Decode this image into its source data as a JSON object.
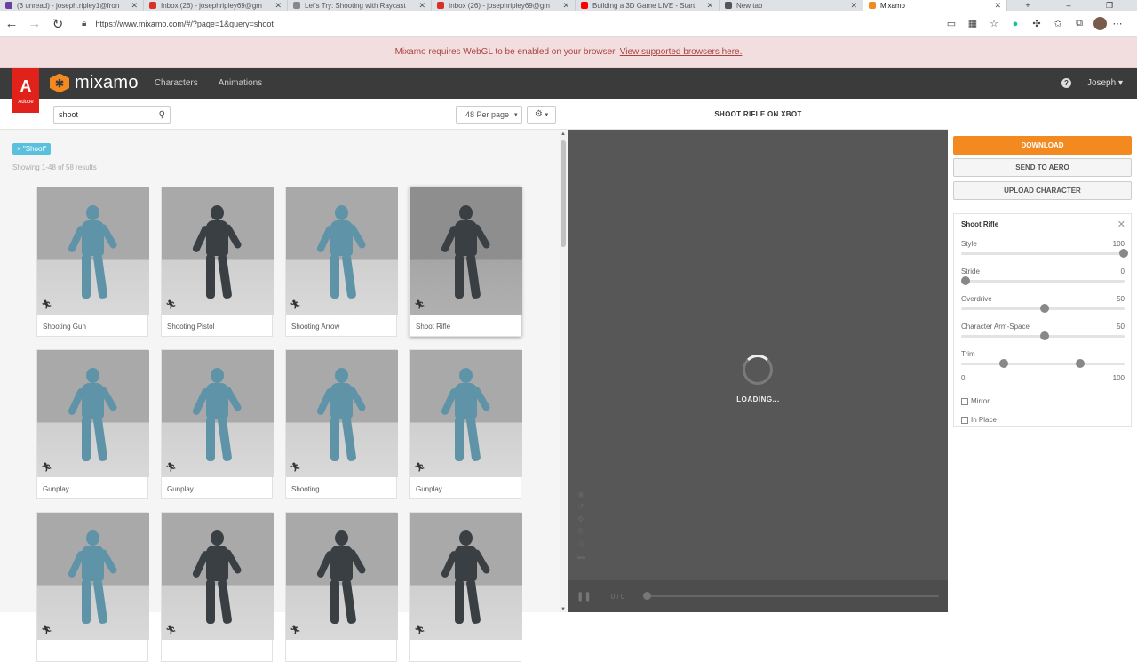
{
  "browser": {
    "tabs": [
      {
        "title": "(3 unread) - joseph.ripley1@fron",
        "color": "#6b3fa0"
      },
      {
        "title": "Inbox (26) - josephripley69@gm",
        "color": "#d93025"
      },
      {
        "title": "Let's Try: Shooting with Raycast",
        "color": "#888888"
      },
      {
        "title": "Inbox (26) - josephripley69@gm",
        "color": "#d93025"
      },
      {
        "title": "Building a 3D Game LIVE - Start",
        "color": "#ff0000"
      },
      {
        "title": "New tab",
        "color": "#555555"
      },
      {
        "title": "Mixamo",
        "color": "#f28a20"
      }
    ],
    "url": "https://www.mixamo.com/#/?page=1&query=shoot"
  },
  "webgl_banner": {
    "text": "Mixamo requires WebGL to be enabled on your browser.",
    "link": "View supported browsers here."
  },
  "header": {
    "adobe_label": "Adobe",
    "logo": "mixamo",
    "nav": [
      "Characters",
      "Animations"
    ],
    "user": "Joseph"
  },
  "search": {
    "query": "shoot",
    "per_page": "48 Per page",
    "tag": "× \"Shoot\"",
    "results": "Showing 1-48 of 58 results"
  },
  "cards": [
    {
      "label": "Shooting Gun",
      "style": "blue"
    },
    {
      "label": "Shooting Pistol",
      "style": "dark"
    },
    {
      "label": "Shooting Arrow",
      "style": "blue"
    },
    {
      "label": "Shoot Rifle",
      "style": "dark",
      "selected": true
    },
    {
      "label": "Gunplay",
      "style": "blue"
    },
    {
      "label": "Gunplay",
      "style": "blue"
    },
    {
      "label": "Shooting",
      "style": "blue"
    },
    {
      "label": "Gunplay",
      "style": "blue"
    },
    {
      "label": "",
      "style": "blue"
    },
    {
      "label": "",
      "style": "dark"
    },
    {
      "label": "",
      "style": "dark"
    },
    {
      "label": "",
      "style": "dark"
    }
  ],
  "viewer": {
    "title": "SHOOT RIFLE ON XBOT",
    "loading": "LOADING...",
    "counter": "0 / 0"
  },
  "actions": {
    "download": "DOWNLOAD",
    "send": "SEND TO AERO",
    "upload": "UPLOAD CHARACTER"
  },
  "settings": {
    "title": "Shoot Rifle",
    "sliders": [
      {
        "name": "Style",
        "value": 100,
        "max": 100
      },
      {
        "name": "Stride",
        "value": 0,
        "max": 100
      },
      {
        "name": "Overdrive",
        "value": 50,
        "max": 100
      },
      {
        "name": "Character Arm-Space",
        "value": 50,
        "max": 100
      }
    ],
    "trim": {
      "name": "Trim",
      "start": 0,
      "end": 100,
      "handle_start": 0.26,
      "handle_end": 0.73
    },
    "mirror": "Mirror",
    "in_place": "In Place"
  }
}
